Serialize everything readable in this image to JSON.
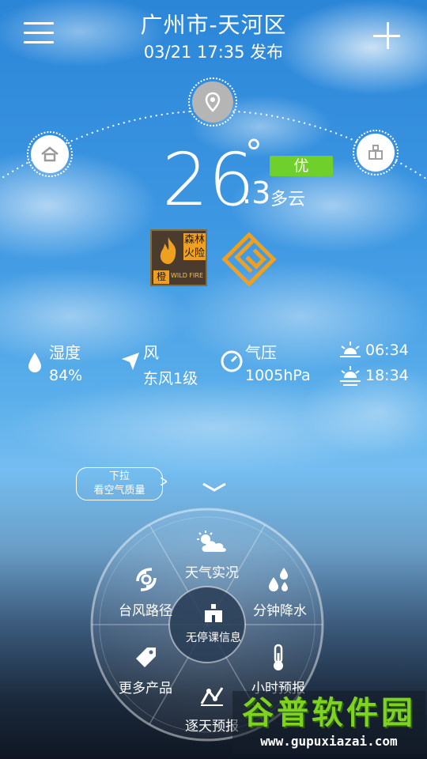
{
  "header": {
    "location": "广州市-天河区",
    "published": "03/21  17:35 发布"
  },
  "weather": {
    "temp_int": "26",
    "temp_deg": "°",
    "temp_frac": ".3",
    "condition": "多云",
    "aqi": "优"
  },
  "warnings": {
    "fire_cn_1": "森林",
    "fire_cn_2": "火险",
    "fire_level": "橙",
    "fire_en": "WILD FIRE"
  },
  "stats": [
    {
      "label": "湿度",
      "value": "84%"
    },
    {
      "label": "风",
      "value": "东风1级"
    },
    {
      "label": "气压",
      "value": "1005hPa"
    }
  ],
  "sun": {
    "rise": "06:34",
    "set": "18:34"
  },
  "pull_hint": {
    "line1": "下拉",
    "line2": "看空气质量"
  },
  "wheel": {
    "center": "无停课信息",
    "items": [
      "天气实况",
      "分钟降水",
      "小时预报",
      "逐天预报",
      "更多产品",
      "台风路径"
    ]
  },
  "watermark": {
    "title": "谷普软件园",
    "url": "www.gupuxiazai.com"
  },
  "colors": {
    "aqi_good": "#6fcf2b",
    "fire_orange": "#f0a020"
  }
}
